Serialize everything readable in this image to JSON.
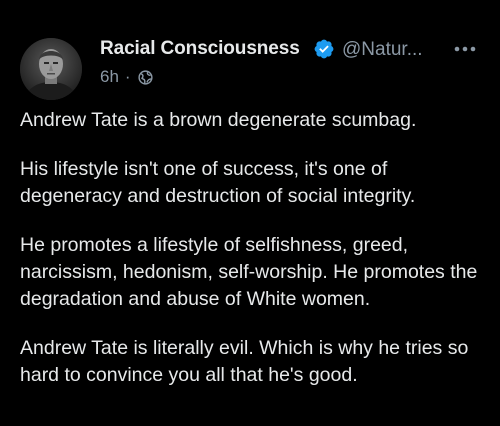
{
  "post": {
    "display_name": "Racial Consciousness",
    "handle": "@Natur...",
    "timestamp": "6h",
    "separator": "·",
    "audience_icon": "globe-icon",
    "verified_icon": "verified-badge-icon",
    "more_icon": "more-options-icon",
    "paragraphs": [
      "Andrew Tate is a brown degenerate scumbag.",
      "His lifestyle isn't one of success, it's one of degeneracy and destruction of social integrity.",
      "He promotes a lifestyle of selfishness, greed, narcissism, hedonism, self-worship. He promotes the degradation and abuse of White women.",
      "Andrew Tate is literally evil. Which is why he tries so hard to convince you all that he's good."
    ]
  },
  "colors": {
    "background": "#000000",
    "primary_text": "#e7e9ea",
    "secondary_text": "#8b98a5",
    "verified_blue": "#1d9bf0"
  }
}
